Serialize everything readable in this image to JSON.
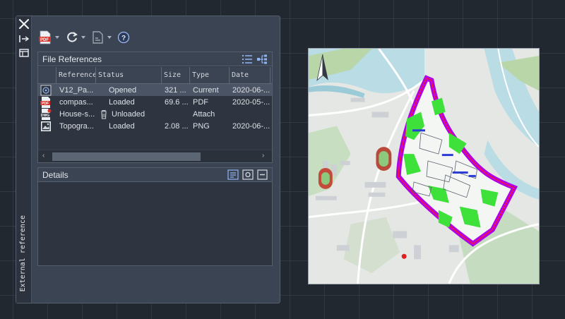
{
  "palette": {
    "title": "External reference",
    "toolbar": {
      "attach_icon": "pdf-attach-icon",
      "refresh_icon": "refresh-icon",
      "change_path_icon": "path-icon",
      "help_icon": "help-icon"
    },
    "file_references": {
      "title": "File References",
      "columns": [
        "Reference",
        "Status",
        "Size",
        "Type",
        "Date"
      ],
      "rows": [
        {
          "icon": "dwg-current-icon",
          "name": "V12_Pa...",
          "status": "Opened",
          "size": "321 ...",
          "type": "Current",
          "date": "2020-06-..."
        },
        {
          "icon": "pdf-file-icon",
          "name": "compas...",
          "status": "Loaded",
          "size": "69.6 ...",
          "type": "PDF",
          "date": "2020-05-..."
        },
        {
          "icon": "dwg-file-icon",
          "name": "House-s...",
          "status": "Unloaded",
          "size": "",
          "type": "Attach",
          "date": ""
        },
        {
          "icon": "image-file-icon",
          "name": "Topogra...",
          "status": "Loaded",
          "size": "2.08 ...",
          "type": "PNG",
          "date": "2020-06-..."
        }
      ]
    },
    "details": {
      "title": "Details"
    }
  },
  "colors": {
    "canvas": "#212830",
    "panel": "#3b4453",
    "boundary": "#b100e8",
    "green_space": "#3ee03a",
    "water": "#a9d3df"
  }
}
